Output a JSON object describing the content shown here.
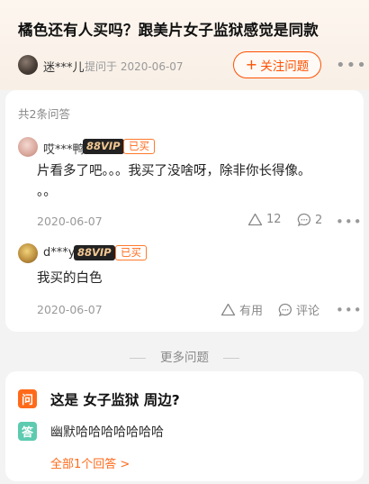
{
  "question": {
    "title": "橘色还有人买吗？跟美片女子监狱感觉是同款",
    "asker_name": "迷***儿",
    "asked_meta": "提问于 2020-06-07",
    "follow_label": "关注问题"
  },
  "answers_section": {
    "count_label": "共2条问答",
    "answers": [
      {
        "user": "哎***鸭",
        "vip": "88VIP",
        "bought": "已买",
        "text_line1": "片看多了吧。。。我买了没啥呀，除非你长得像。",
        "text_line2": "。。",
        "date": "2020-06-07",
        "likes": "12",
        "comments": "2"
      },
      {
        "user": "d***y",
        "vip": "88VIP",
        "bought": "已买",
        "text_line1": "我买的白色",
        "date": "2020-06-07",
        "useful_label": "有用",
        "comment_label": "评论"
      }
    ]
  },
  "more_questions": {
    "heading": "更多问题",
    "q_badge": "问",
    "a_badge": "答",
    "question": "这是 女子监狱 周边?",
    "answer": "幽默哈哈哈哈哈哈哈",
    "all_answers_link": "全部1个回答 >"
  },
  "icons": [
    "avatar",
    "plus-icon",
    "more-icon",
    "triangle-like-icon",
    "comment-icon"
  ],
  "colors": {
    "accent": "#ff5000",
    "answer_badge": "#5ccbb0",
    "vip_bg": "#222222"
  }
}
